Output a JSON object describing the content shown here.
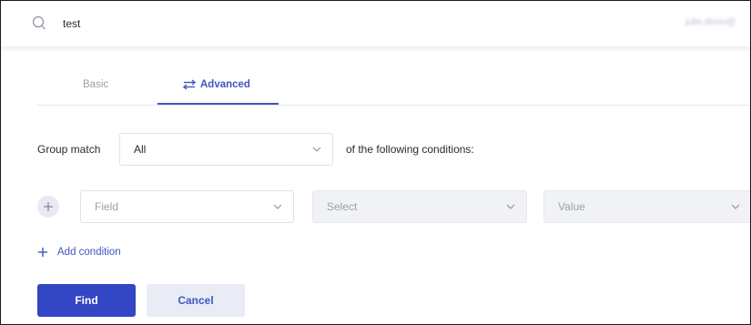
{
  "search": {
    "value": "test",
    "icon": "search-icon",
    "user_email": "julie.dixon@"
  },
  "tabs": [
    {
      "label": "Basic",
      "active": false
    },
    {
      "label": "Advanced",
      "active": true,
      "icon": "sliders-icon"
    }
  ],
  "group_match": {
    "label": "Group match",
    "selected": "All",
    "suffix": "of the following conditions:"
  },
  "condition": {
    "field_placeholder": "Field",
    "operator_placeholder": "Select",
    "value_placeholder": "Value",
    "add_icon": "plus-icon"
  },
  "add_condition": {
    "label": "Add condition",
    "icon": "plus-icon"
  },
  "actions": {
    "find_label": "Find",
    "cancel_label": "Cancel"
  },
  "colors": {
    "accent": "#3f56c2",
    "primary_button": "#3346c4",
    "secondary_button": "#e9ebf5",
    "muted_text": "#9aa0ab",
    "disabled_field": "#f1f2f6"
  }
}
